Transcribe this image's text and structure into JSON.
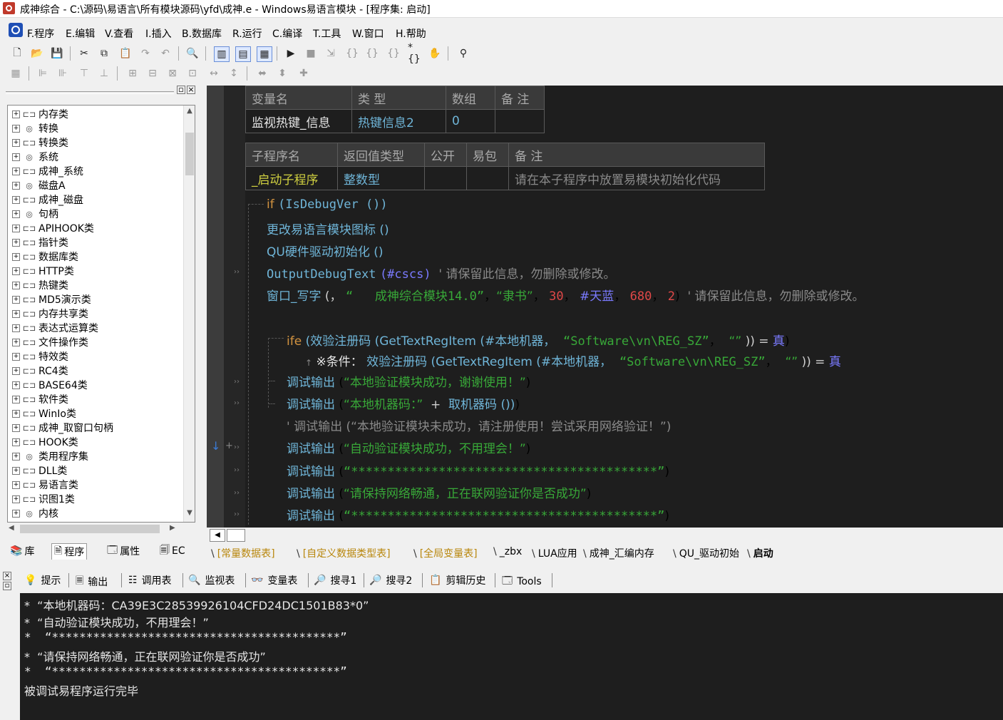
{
  "window": {
    "title": "成神综合 - C:\\源码\\易语言\\所有模块源码\\yfd\\成神.e - Windows易语言模块 - [程序集: 启动]"
  },
  "menu": [
    {
      "label": "F.程序"
    },
    {
      "label": "E.编辑"
    },
    {
      "label": "V.查看"
    },
    {
      "label": "I.插入"
    },
    {
      "label": "B.数据库"
    },
    {
      "label": "R.运行"
    },
    {
      "label": "C.编译"
    },
    {
      "label": "T.工具"
    },
    {
      "label": "W.窗口"
    },
    {
      "label": "H.帮助"
    }
  ],
  "tree": {
    "items": [
      {
        "label": "内存类",
        "icon": "class-icon"
      },
      {
        "label": "转换",
        "icon": "module-icon"
      },
      {
        "label": "转换类",
        "icon": "class-icon"
      },
      {
        "label": "系统",
        "icon": "module-icon"
      },
      {
        "label": "成神_系统",
        "icon": "class-icon"
      },
      {
        "label": "磁盘A",
        "icon": "module-icon"
      },
      {
        "label": "成神_磁盘",
        "icon": "class-icon"
      },
      {
        "label": "句柄",
        "icon": "module-icon"
      },
      {
        "label": "APIHOOK类",
        "icon": "class-icon"
      },
      {
        "label": "指针类",
        "icon": "class-icon"
      },
      {
        "label": "数据库类",
        "icon": "class-icon"
      },
      {
        "label": "HTTP类",
        "icon": "class-icon"
      },
      {
        "label": "热键类",
        "icon": "class-icon"
      },
      {
        "label": "MD5演示类",
        "icon": "class-icon"
      },
      {
        "label": "内存共享类",
        "icon": "class-icon"
      },
      {
        "label": "表达式运算类",
        "icon": "class-icon"
      },
      {
        "label": "文件操作类",
        "icon": "class-icon"
      },
      {
        "label": "特效类",
        "icon": "class-icon"
      },
      {
        "label": "RC4类",
        "icon": "class-icon"
      },
      {
        "label": "BASE64类",
        "icon": "class-icon"
      },
      {
        "label": "软件类",
        "icon": "class-icon"
      },
      {
        "label": "WinIo类",
        "icon": "class-icon"
      },
      {
        "label": "成神_取窗口句柄",
        "icon": "class-icon"
      },
      {
        "label": "HOOK类",
        "icon": "class-icon"
      },
      {
        "label": "类用程序集",
        "icon": "module-icon"
      },
      {
        "label": "DLL类",
        "icon": "class-icon"
      },
      {
        "label": "易语言类",
        "icon": "class-icon"
      },
      {
        "label": "识图1类",
        "icon": "class-icon"
      },
      {
        "label": "内核",
        "icon": "module-icon"
      }
    ]
  },
  "left_tabs": [
    {
      "label": "库"
    },
    {
      "label": "程序"
    },
    {
      "label": "属性"
    },
    {
      "label": "EC"
    }
  ],
  "var_table": {
    "headers": [
      "变量名",
      "类 型",
      "数组",
      "备 注"
    ],
    "row": [
      "监视热键_信息",
      "热键信息2",
      "0",
      ""
    ]
  },
  "sub_table": {
    "headers": [
      "子程序名",
      "返回值类型",
      "公开",
      "易包",
      "备 注"
    ],
    "row": [
      "_启动子程序",
      "整数型",
      "",
      "",
      "请在本子程序中放置易模块初始化代码"
    ]
  },
  "code": {
    "l1_kw": "if",
    "l1_fn": "(IsDebugVer ())",
    "l2": "更改易语言模块图标 ()",
    "l3": "QU硬件驱动初始化 ()",
    "l4_fn": "OutputDebugText",
    "l4_arg": "(#cscs)",
    "l4_cmt": "' 请保留此信息，勿删除或修改。",
    "l5_fn": "窗口_写字",
    "l5_a": "(，",
    "l5_s1": "“   成神综合模块14.0”",
    "l5_s2": "“隶书”",
    "l5_n1": "30",
    "l5_c": "#天蓝",
    "l5_n2": "680",
    "l5_n3": "2",
    "l5_cmt": "' 请保留此信息，勿删除或修改。",
    "l6_kw": "ife",
    "l6_fn": "(效验注册码 (GetTextRegItem (#本地机器，",
    "l6_s": "“Software\\vn\\REG_SZ”",
    "l6_s2": "“”",
    "l6_end": ")) =",
    "l6_true": "真",
    "l7_label": "※条件：",
    "l7_fn": "效验注册码 (GetTextRegItem (#本地机器，",
    "l7_s": "“Software\\vn\\REG_SZ”",
    "l7_s2": "“”",
    "l7_end": ")) =",
    "l7_true": "真",
    "l8_fn": "调试输出",
    "l8_s": "“本地验证模块成功，谢谢使用！”",
    "l9_fn": "调试输出",
    "l9_s": "“本地机器码：”",
    "l9_plus": "+",
    "l9_fn2": "取机器码 ())",
    "l10_cmt": "' 调试输出 (“本地验证模块未成功，请注册使用！尝试采用网络验证！”)",
    "l11_fn": "调试输出",
    "l11_s": "“自动验证模块成功，不用理会！”",
    "l12_fn": "调试输出",
    "l12_s": "“******************************************”",
    "l13_fn": "调试输出",
    "l13_s": "“请保持网络畅通，正在联网验证你是否成功”",
    "l14_fn": "调试输出",
    "l14_s": "“******************************************”"
  },
  "file_tabs": [
    {
      "label": "[常量数据表]",
      "color": "#b8860b"
    },
    {
      "label": "[自定义数据类型表]",
      "color": "#b8860b"
    },
    {
      "label": "[全局变量表]",
      "color": "#b8860b"
    },
    {
      "label": "_zbx",
      "color": "#000000"
    },
    {
      "label": "LUA应用",
      "color": "#000000"
    },
    {
      "label": "成神_汇编内存",
      "color": "#000000"
    },
    {
      "label": "QU_驱动初始",
      "color": "#000000"
    },
    {
      "label": "启动",
      "color": "#000000"
    }
  ],
  "bottom_tabs": [
    {
      "label": "提示"
    },
    {
      "label": "输出"
    },
    {
      "label": "调用表"
    },
    {
      "label": "监视表"
    },
    {
      "label": "变量表"
    },
    {
      "label": "搜寻1"
    },
    {
      "label": "搜寻2"
    },
    {
      "label": "剪辑历史"
    },
    {
      "label": "Tools"
    }
  ],
  "output": [
    "*  “本地机器码：CA39E3C28539926104CFD24DC1501B83*0”",
    "*  “自动验证模块成功，不用理会！”",
    "*  “******************************************”",
    "*  “请保持网络畅通，正在联网验证你是否成功”",
    "*  “******************************************”",
    "被调试易程序运行完毕"
  ]
}
